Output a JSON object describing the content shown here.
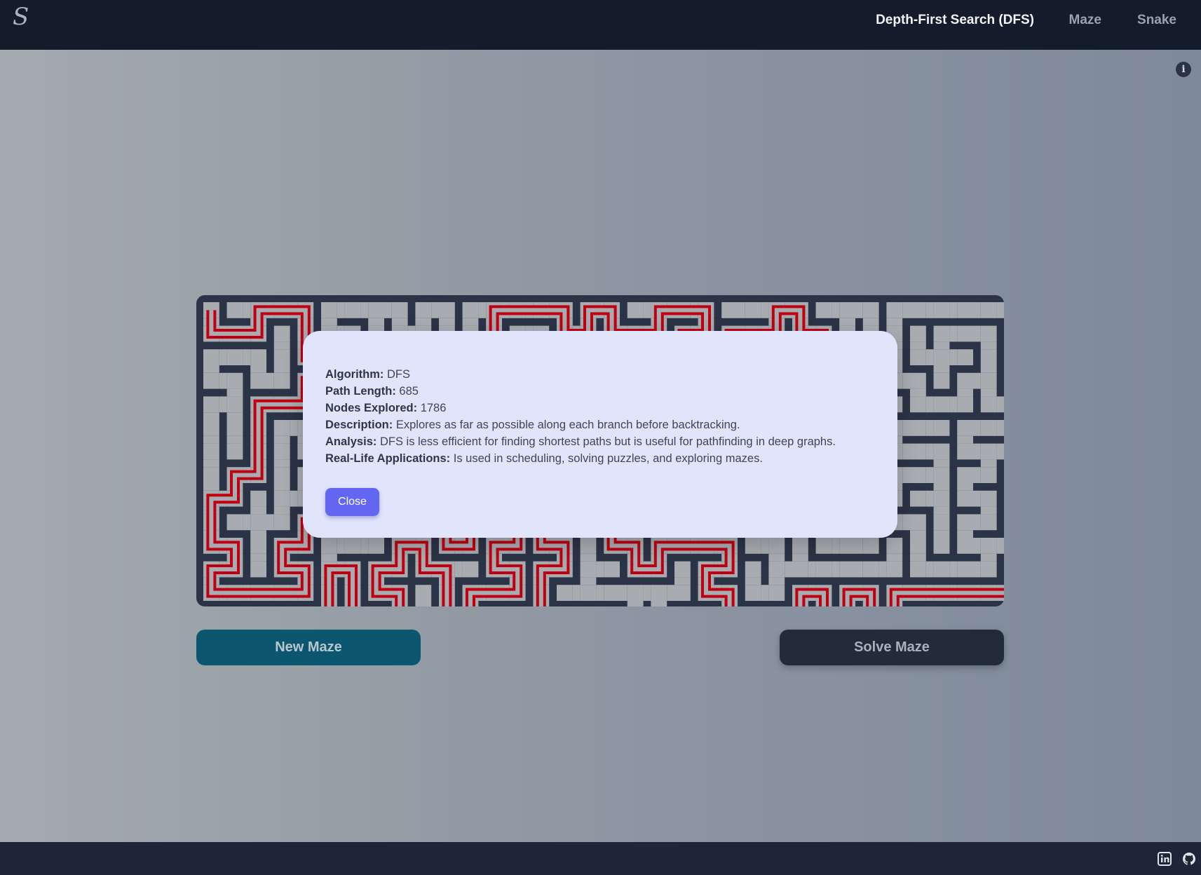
{
  "header": {
    "logo_text": "S",
    "algorithm_title": "Depth-First Search (DFS)",
    "nav": {
      "maze": "Maze",
      "snake": "Snake"
    }
  },
  "info_icon": {
    "icon": "info-icon",
    "glyph": "i"
  },
  "maze": {
    "colors": {
      "wall": "#2b3346",
      "path": "#a8acb1",
      "solution": "#c00010"
    }
  },
  "buttons": {
    "new_maze": "New Maze",
    "solve_maze": "Solve Maze"
  },
  "modal": {
    "algorithm_label": "Algorithm:",
    "algorithm_value": "DFS",
    "path_length_label": "Path Length:",
    "path_length_value": "685",
    "nodes_explored_label": "Nodes Explored:",
    "nodes_explored_value": "1786",
    "description_label": "Description:",
    "description_value": "Explores as far as possible along each branch before backtracking.",
    "analysis_label": "Analysis:",
    "analysis_value": "DFS is less efficient for finding shortest paths but is useful for pathfinding in deep graphs.",
    "applications_label": "Real-Life Applications:",
    "applications_value": "Is used in scheduling, solving puzzles, and exploring mazes.",
    "close_label": "Close"
  },
  "footer": {
    "icons": [
      "linkedin-icon",
      "github-icon"
    ]
  }
}
